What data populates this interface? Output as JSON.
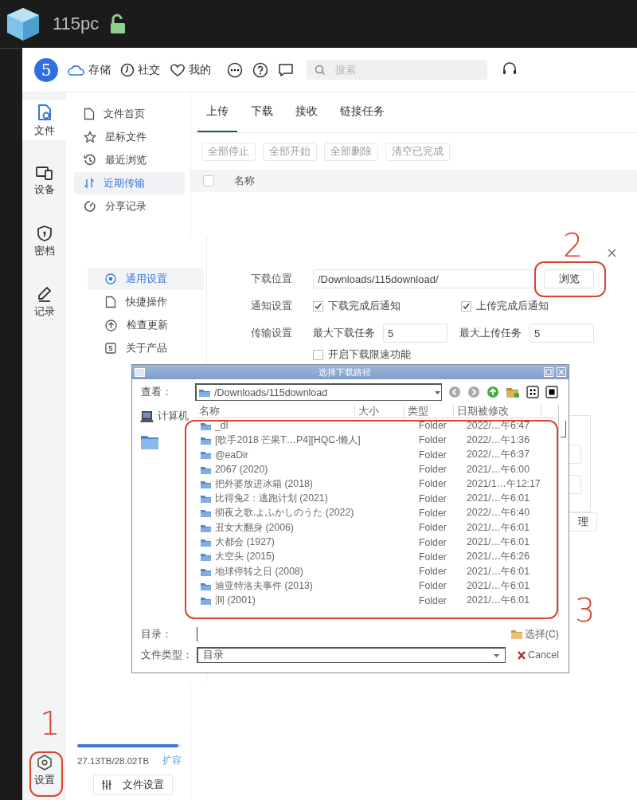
{
  "titlebar": {
    "app_name": "115pc"
  },
  "header": {
    "logo": "5",
    "nav": [
      {
        "label": "存储"
      },
      {
        "label": "社交"
      },
      {
        "label": "我的"
      }
    ],
    "search": {
      "placeholder": "搜索"
    }
  },
  "rail": {
    "items": [
      {
        "label": "文件",
        "selected": true
      },
      {
        "label": "设备",
        "selected": false
      },
      {
        "label": "密档",
        "selected": false
      },
      {
        "label": "记录",
        "selected": false
      }
    ],
    "settings": {
      "label": "设置"
    }
  },
  "sidebar": {
    "items": [
      {
        "label": "文件首页",
        "selected": false
      },
      {
        "label": "星标文件",
        "selected": false
      },
      {
        "label": "最近浏览",
        "selected": false
      },
      {
        "label": "近期传输",
        "selected": true
      },
      {
        "label": "分享记录",
        "selected": false
      }
    ],
    "storage": {
      "level": 0.97,
      "usage": "27.13TB/28.02TB",
      "expand": "扩容"
    },
    "settings_button": "文件设置"
  },
  "transfer": {
    "tabs": [
      {
        "label": "上传",
        "selected": true
      },
      {
        "label": "下载",
        "selected": false
      },
      {
        "label": "接收",
        "selected": false
      },
      {
        "label": "链接任务",
        "selected": false
      }
    ],
    "actions": [
      "全部停止",
      "全部开始",
      "全部删除",
      "清空已完成"
    ],
    "table": {
      "select_all_checked": false,
      "columns": [
        "名称"
      ]
    }
  },
  "settings_panel": {
    "nav": [
      {
        "label": "通用设置",
        "selected": true
      },
      {
        "label": "快捷操作",
        "selected": false
      },
      {
        "label": "检查更新",
        "selected": false
      },
      {
        "label": "关于产品",
        "selected": false
      }
    ],
    "download_location": {
      "label": "下载位置",
      "value": "/Downloads/115download/",
      "button": "浏览"
    },
    "notifications": {
      "label": "通知设置",
      "options": [
        {
          "label": "下载完成后通知",
          "checked": true
        },
        {
          "label": "上传完成后通知",
          "checked": true
        }
      ]
    },
    "transfer": {
      "label": "传输设置",
      "max_download": {
        "label": "最大下载任务",
        "value": "5"
      },
      "max_upload": {
        "label": "最大上传任务",
        "value": "5"
      },
      "speed_limit": {
        "label": "开启下载限速功能",
        "checked": false
      }
    },
    "partial_button": "理"
  },
  "file_dialog": {
    "title": "选择下载路径",
    "look_in": {
      "label": "查看：",
      "value": "/Downloads/115download"
    },
    "places": [
      {
        "label": "计算机"
      }
    ],
    "columns": [
      "名称",
      "大小",
      "类型",
      "日期被修改"
    ],
    "rows": [
      {
        "name": "_dl",
        "type": "Folder",
        "modified": "2022/…午6:47"
      },
      {
        "name": "[歌手2018 芒果T…P4][HQC-懒人]",
        "type": "Folder",
        "modified": "2022/…午1:36"
      },
      {
        "name": "@eaDir",
        "type": "Folder",
        "modified": "2022/…午6:37"
      },
      {
        "name": "2067 (2020)",
        "type": "Folder",
        "modified": "2021/…午6:00"
      },
      {
        "name": "把外婆放进冰箱 (2018)",
        "type": "Folder",
        "modified": "2021/1…午12:17"
      },
      {
        "name": "比得兔2：逃跑计划 (2021)",
        "type": "Folder",
        "modified": "2021/…午6:01"
      },
      {
        "name": "彻夜之歌.よふかしのうた (2022)",
        "type": "Folder",
        "modified": "2022/…午6:40"
      },
      {
        "name": "丑女大翻身 (2006)",
        "type": "Folder",
        "modified": "2021/…午6:01"
      },
      {
        "name": "大都会 (1927)",
        "type": "Folder",
        "modified": "2021/…午6:01"
      },
      {
        "name": "大空头 (2015)",
        "type": "Folder",
        "modified": "2021/…午6:26"
      },
      {
        "name": "地球停转之日 (2008)",
        "type": "Folder",
        "modified": "2021/…午6:01"
      },
      {
        "name": "迪亚特洛夫事件 (2013)",
        "type": "Folder",
        "modified": "2021/…午6:01"
      },
      {
        "name": "洞 (2001)",
        "type": "Folder",
        "modified": "2021/…午6:01"
      }
    ],
    "directory": {
      "label": "目录："
    },
    "file_type": {
      "label": "文件类型：",
      "value": "目录"
    },
    "buttons": [
      {
        "label": "选择(C)",
        "kind": "choose"
      },
      {
        "label": "Cancel",
        "kind": "cancel"
      }
    ]
  },
  "annotations": [
    {
      "label": "1"
    },
    {
      "label": "2"
    },
    {
      "label": "3"
    }
  ]
}
